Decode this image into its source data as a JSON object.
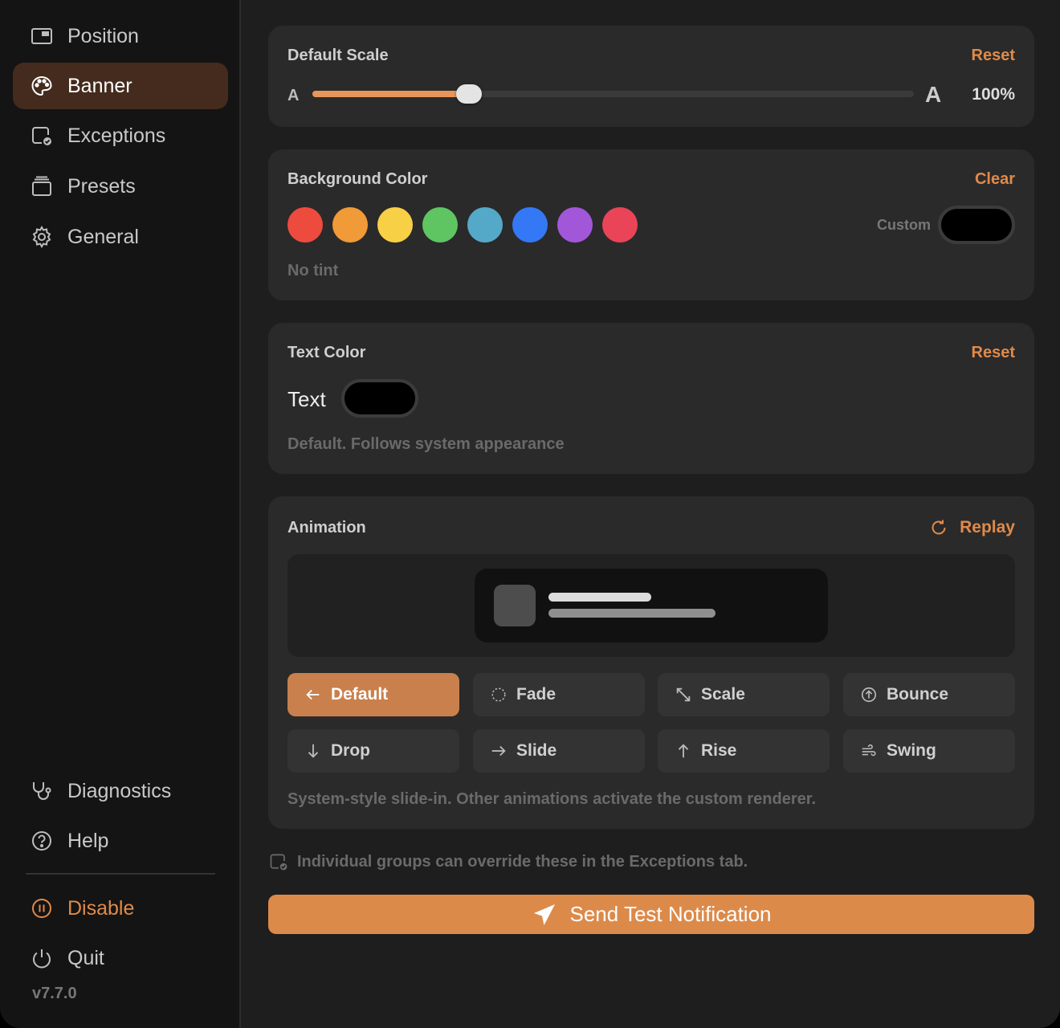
{
  "sidebar": {
    "top_items": [
      {
        "label": "Position",
        "icon": "position-icon"
      },
      {
        "label": "Banner",
        "icon": "palette-icon",
        "active": true
      },
      {
        "label": "Exceptions",
        "icon": "exceptions-icon"
      },
      {
        "label": "Presets",
        "icon": "stack-icon"
      },
      {
        "label": "General",
        "icon": "gear-icon"
      }
    ],
    "bottom_items": [
      {
        "label": "Diagnostics",
        "icon": "stethoscope-icon"
      },
      {
        "label": "Help",
        "icon": "question-icon"
      },
      {
        "label": "Disable",
        "icon": "pause-icon"
      },
      {
        "label": "Quit",
        "icon": "power-icon"
      }
    ],
    "version": "v7.7.0",
    "accent_color": "#e08a49",
    "active_bg": "#442b1d"
  },
  "scale": {
    "title": "Default Scale",
    "action": "Reset",
    "min_label": "A",
    "max_label": "A",
    "value_label": "100%",
    "slider_fraction": 0.26
  },
  "background": {
    "title": "Background Color",
    "action": "Clear",
    "swatches": [
      "#ee4b3f",
      "#f19a38",
      "#f8d046",
      "#5ec562",
      "#55a9c8",
      "#3478f6",
      "#a257d9",
      "#ea4458"
    ],
    "custom_label": "Custom",
    "custom_color": "#000000",
    "status": "No tint"
  },
  "text_color": {
    "title": "Text Color",
    "action": "Reset",
    "label": "Text",
    "color": "#000000",
    "status": "Default. Follows system appearance"
  },
  "animation": {
    "title": "Animation",
    "action": "Replay",
    "options": [
      {
        "label": "Default",
        "icon": "arrow-left-icon",
        "selected": true
      },
      {
        "label": "Fade",
        "icon": "dashed-circle-icon"
      },
      {
        "label": "Scale",
        "icon": "expand-icon"
      },
      {
        "label": "Bounce",
        "icon": "arrow-up-circle-icon"
      },
      {
        "label": "Drop",
        "icon": "arrow-down-icon"
      },
      {
        "label": "Slide",
        "icon": "arrow-right-icon"
      },
      {
        "label": "Rise",
        "icon": "arrow-up-icon"
      },
      {
        "label": "Swing",
        "icon": "wind-icon"
      }
    ],
    "description": "System-style slide-in. Other animations activate the custom renderer."
  },
  "footnote": "Individual groups can override these in the Exceptions tab.",
  "send_button": "Send Test Notification"
}
